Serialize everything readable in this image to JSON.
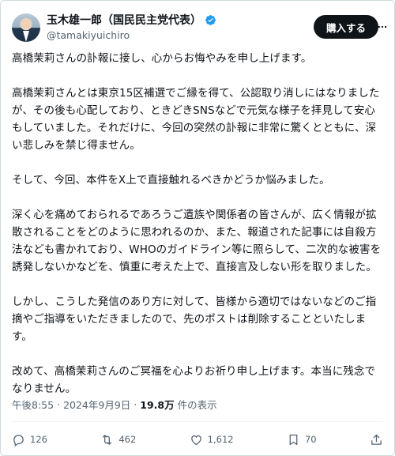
{
  "author": {
    "display_name": "玉木雄一郎（国民民主党代表）",
    "handle": "@tamakiyuichiro",
    "verified_icon": "verified-badge-icon",
    "verified_color": "#1d9bf0"
  },
  "header": {
    "subscribe_label": "購入する",
    "more_icon": "more-icon"
  },
  "post": {
    "paragraphs": [
      "高橋茉莉さんの訃報に接し、心からお悔やみを申し上げます。",
      "高橋茉莉さんとは東京15区補選でご縁を得て、公認取り消しにはなりましたが、その後も心配しており、ときどきSNSなどで元気な様子を拝見して安心もしていました。それだけに、今回の突然の訃報に非常に驚くとともに、深い悲しみを禁じ得ません。",
      "そして、今回、本件をX上で直接触れるべきかどうか悩みました。",
      "深く心を痛めておられるであろうご遺族や関係者の皆さんが、広く情報が拡散されることをどのように思われるのか、また、報道された記事には自殺方法なども書かれており、WHOのガイドライン等に照らして、二次的な被害を誘発しないかなどを、慎重に考えた上で、直接言及しない形を取りました。",
      "しかし、こうした発信のあり方に対して、皆様から適切ではないなどのご指摘やご指導をいただきましたので、先のポストは削除することといたします。",
      "改めて、高橋茉莉さんのご冥福を心よりお祈り申し上げます。本当に残念でなりません。"
    ]
  },
  "meta": {
    "time": "午後8:55",
    "separator": "·",
    "date": "2024年9月9日",
    "views_count": "19.8万",
    "views_label": "件の表示"
  },
  "actions": {
    "reply": {
      "icon": "reply-icon",
      "count": "126"
    },
    "repost": {
      "icon": "repost-icon",
      "count": "462"
    },
    "like": {
      "icon": "heart-icon",
      "count": "1,612"
    },
    "bookmark": {
      "icon": "bookmark-icon",
      "count": "70"
    },
    "share": {
      "icon": "share-icon"
    }
  }
}
